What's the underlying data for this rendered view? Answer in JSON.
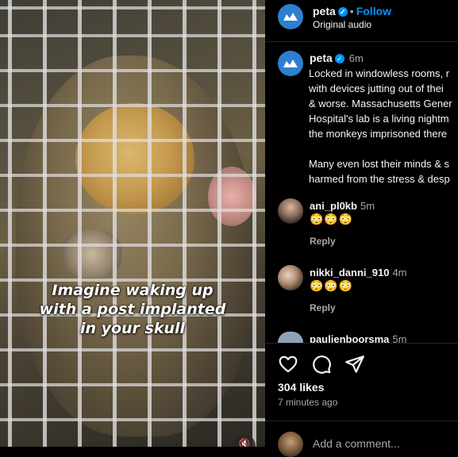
{
  "media": {
    "overlay_lines": [
      "Imagine waking up",
      "with a post implanted",
      "in your skull"
    ],
    "mute_icon": "speaker-muted-icon"
  },
  "header": {
    "username": "peta",
    "follow_label": "Follow",
    "audio_label": "Original audio",
    "avatar_icon": "peta-logo-icon"
  },
  "caption": {
    "username": "peta",
    "time": "6m",
    "lines": [
      "Locked in windowless rooms, r",
      "with devices jutting out of thei",
      "& worse. Massachusetts Gener",
      "Hospital's lab is a living nightm",
      "the monkeys imprisoned there",
      "",
      "Many even lost their minds & s",
      "harmed from the stress & desp"
    ]
  },
  "comments": [
    {
      "username": "ani_pl0kb",
      "time": "5m",
      "text": "😳😳😳",
      "reply_label": "Reply"
    },
    {
      "username": "nikki_danni_910",
      "time": "4m",
      "text": "😳😳😳",
      "reply_label": "Reply"
    },
    {
      "username": "paulienboorsma",
      "time": "5m",
      "text": "",
      "reply_label": ""
    }
  ],
  "actions": {
    "like_icon": "heart-icon",
    "comment_icon": "comment-icon",
    "share_icon": "send-icon"
  },
  "likes_label": "304 likes",
  "posted_label": "7 minutes ago",
  "add_comment_placeholder": "Add a comment...",
  "colors": {
    "accent": "#0095f6",
    "muted": "#a8a8a8",
    "background": "#000000",
    "peta_blue": "#2f7fcf"
  }
}
